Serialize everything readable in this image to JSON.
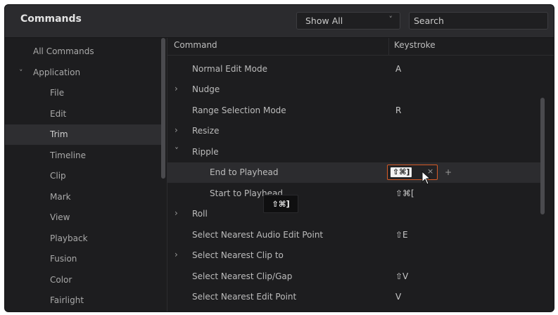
{
  "header": {
    "title": "Commands",
    "filter_value": "Show All",
    "search_placeholder": "Search"
  },
  "sidebar": {
    "items": [
      {
        "label": "All Commands"
      },
      {
        "label": "Application"
      },
      {
        "label": "File"
      },
      {
        "label": "Edit"
      },
      {
        "label": "Trim"
      },
      {
        "label": "Timeline"
      },
      {
        "label": "Clip"
      },
      {
        "label": "Mark"
      },
      {
        "label": "View"
      },
      {
        "label": "Playback"
      },
      {
        "label": "Fusion"
      },
      {
        "label": "Color"
      },
      {
        "label": "Fairlight"
      }
    ],
    "selected": "Trim"
  },
  "table": {
    "col_command": "Command",
    "col_keystroke": "Keystroke",
    "rows": [
      {
        "command": "Normal Edit Mode",
        "key": "A"
      },
      {
        "command": "Nudge",
        "key": ""
      },
      {
        "command": "Range Selection Mode",
        "key": "R"
      },
      {
        "command": "Resize",
        "key": ""
      },
      {
        "command": "Ripple",
        "key": ""
      },
      {
        "command": "End to Playhead",
        "key": ""
      },
      {
        "command": "Start to Playhead",
        "key": "⇧⌘["
      },
      {
        "command": "Roll",
        "key": ""
      },
      {
        "command": "Select Nearest Audio Edit Point",
        "key": "⇧E"
      },
      {
        "command": "Select Nearest Clip to",
        "key": ""
      },
      {
        "command": "Select Nearest Clip/Gap",
        "key": "⇧V"
      },
      {
        "command": "Select Nearest Edit Point",
        "key": "V"
      }
    ]
  },
  "editing": {
    "key_chip": "⇧⌘]",
    "clear_glyph": "×",
    "add_glyph": "+",
    "tooltip": "⇧⌘]"
  },
  "icons": {
    "expand_closed": "›",
    "expand_open": "˅",
    "dropdown": "˅"
  },
  "colors": {
    "focus_border": "#d65a26",
    "background": "#1d1d1f"
  }
}
